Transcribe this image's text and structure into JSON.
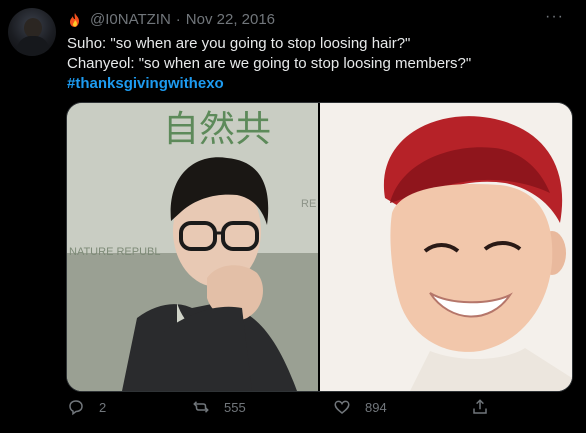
{
  "tweet": {
    "handle": "@I0NATZIN",
    "separator": "·",
    "date": "Nov 22, 2016",
    "more": "···",
    "lines": [
      "Suho: \"so when are you going to stop loosing hair?\"",
      "Chanyeol: \"so when are we going to stop loosing members?\""
    ],
    "hashtag": "#thanksgivingwithexo",
    "media": {
      "left_sign_text": "自然共",
      "left_brand_text": "NATURE REPUBL",
      "left_sign_partial": "RE"
    },
    "actions": {
      "reply_count": "2",
      "retweet_count": "555",
      "like_count": "894"
    }
  },
  "colors": {
    "background": "#000000",
    "text": "#e7e9ea",
    "secondary": "#71767b",
    "link": "#1d9bf0"
  },
  "icons": [
    "fire-icon",
    "more-icon",
    "reply-icon",
    "retweet-icon",
    "like-icon",
    "share-icon"
  ]
}
